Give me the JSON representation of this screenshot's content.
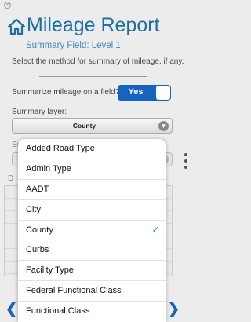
{
  "window": {
    "close_glyph": "✕"
  },
  "header": {
    "title": "Mileage Report",
    "subtitle": "Summary Field: Level 1",
    "icon": "home-icon"
  },
  "instruction": "Select the method for summary of mileage, if any.",
  "summarize": {
    "label": "Summarize mileage on a field?",
    "toggle_label": "Yes",
    "toggle_on": true
  },
  "summary_layer": {
    "label": "Summary layer:",
    "selected": "County"
  },
  "background": {
    "su_fragment": "Su",
    "d_fragment": "D"
  },
  "dropdown": {
    "options": [
      "Added Road Type",
      "Admin Type",
      "AADT",
      "City",
      "County",
      "Curbs",
      "Facility Type",
      "Federal Functional Class",
      "Functional Class"
    ],
    "selected_index": 4,
    "check_glyph": "✓"
  },
  "colors": {
    "accent": "#1565c0",
    "title": "#1a6fa8",
    "check": "#1a73d9"
  }
}
